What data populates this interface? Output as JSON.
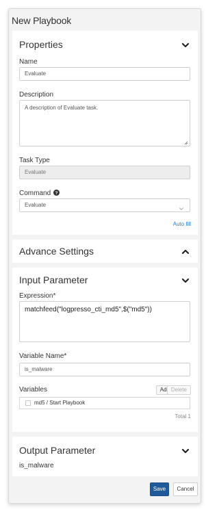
{
  "dialog": {
    "title": "New Playbook"
  },
  "properties": {
    "header": "Properties",
    "name_label": "Name",
    "name_value": "Evaluate",
    "description_label": "Description",
    "description_value": "A description of Evaluate task.",
    "task_type_label": "Task Type",
    "task_type_value": "Evaluate",
    "command_label": "Command",
    "command_value": "Evaluate",
    "auto_fill": "Auto fill"
  },
  "advance": {
    "header": "Advance Settings"
  },
  "input_parameter": {
    "header": "Input Parameter",
    "expression_label": "Expression*",
    "expression_value": "matchfeed(\"logpresso_cti_md5\",$(\"md5\"))",
    "variable_name_label": "Variable Name*",
    "variable_name_value": "is_malware",
    "variables_label": "Variables",
    "add_label": "Add",
    "delete_label": "Delete",
    "variables": [
      {
        "label": "md5 / Start Playbook",
        "checked": false
      }
    ],
    "total": "Total 1"
  },
  "output_parameter": {
    "header": "Output Parameter",
    "value": "is_malware"
  },
  "footer": {
    "save_label": "Save",
    "cancel_label": "Cancel"
  },
  "colors": {
    "primary": "#1f5a9b",
    "link": "#2a7bd3",
    "panel_bg": "#f3f3f3"
  },
  "icons": {
    "section_collapse": "chevron-down-icon",
    "section_expand": "chevron-up-icon",
    "help": "question-circle-icon",
    "select": "chevron-down-icon"
  }
}
